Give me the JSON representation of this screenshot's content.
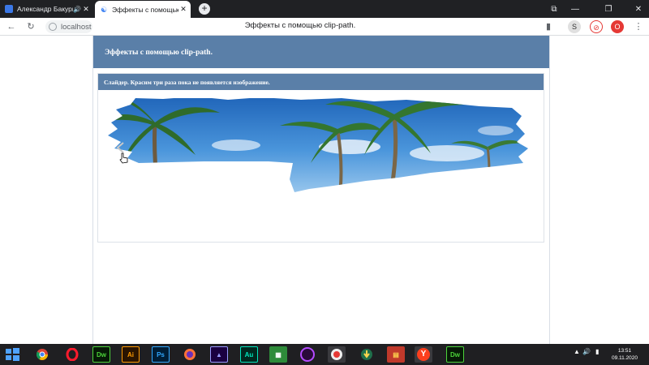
{
  "browser": {
    "tabs": [
      {
        "title": "Александр Бакурш",
        "active": false
      },
      {
        "title": "Эффекты с помощью c",
        "active": true
      }
    ],
    "new_tab_symbol": "+",
    "address": "localhost",
    "page_title": "Эффекты с помощью clip-path.",
    "extensions": [
      "S",
      "⊘",
      "O"
    ],
    "menu_symbol": "⋮",
    "window_controls": [
      "—",
      "❐",
      "✕"
    ]
  },
  "page": {
    "header": "Эффекты с помощью clip-path.",
    "card_title": "Слайдер. Красим три раза пока не появляется изображение."
  },
  "taskbar": {
    "apps": [
      {
        "icon": "chrome-icon",
        "label": ""
      },
      {
        "icon": "opera-icon",
        "label": ""
      },
      {
        "icon": "dreamweaver-icon",
        "label": "Dw"
      },
      {
        "icon": "illustrator-icon",
        "label": "Ai"
      },
      {
        "icon": "photoshop-icon",
        "label": "Ps"
      },
      {
        "icon": "firefox-icon",
        "label": ""
      },
      {
        "icon": "premiere-icon",
        "label": ""
      },
      {
        "icon": "audition-icon",
        "label": "Au"
      },
      {
        "icon": "green-app-icon",
        "label": ""
      },
      {
        "icon": "purple-circle-icon",
        "label": ""
      },
      {
        "icon": "recorder-icon",
        "label": ""
      },
      {
        "icon": "download-app-icon",
        "label": ""
      },
      {
        "icon": "archive-icon",
        "label": ""
      },
      {
        "icon": "yandex-icon",
        "label": "Y"
      },
      {
        "icon": "dreamweaver-icon",
        "label": "Dw"
      }
    ],
    "tray_symbols": [
      "▲",
      "🔊",
      "▮"
    ],
    "time": "13:51",
    "date": "09.11.2020"
  },
  "colors": {
    "page_header_bg": "#5a7fa8",
    "card_header_bg": "#5a7fa8",
    "tab_strip_bg": "#202124",
    "taskbar_bg": "#1f1f22",
    "sky_top": "#1e63b8",
    "sky_bottom": "#8ec0ec"
  }
}
